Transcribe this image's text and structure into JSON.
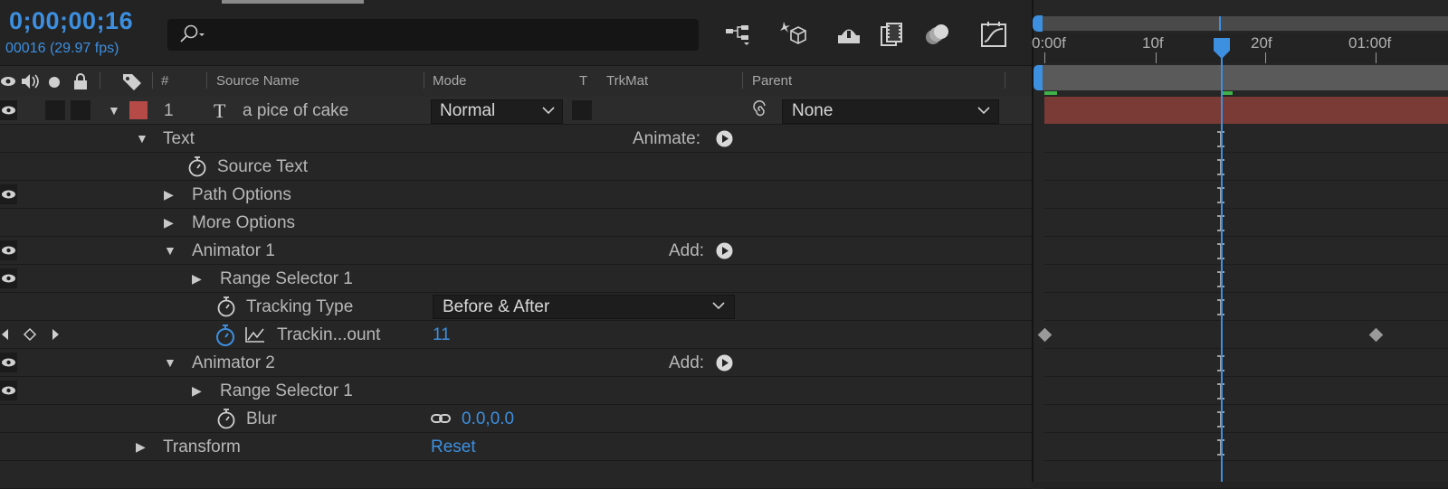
{
  "header": {
    "timecode": "0;00;00;16",
    "frame_info": "00016 (29.97 fps)",
    "search_value": "",
    "tools": [
      "flowchart-icon",
      "draft-3d-icon",
      "shy-layers-icon",
      "frame-blending-icon",
      "motion-blur-icon",
      "graph-editor-icon"
    ]
  },
  "columns": {
    "source_name": "Source Name",
    "mode": "Mode",
    "t": "T",
    "trkmat": "TrkMat",
    "parent": "Parent",
    "number": "#"
  },
  "layer": {
    "number": "1",
    "type_glyph": "T",
    "name": "a pice of cake",
    "mode": "Normal",
    "parent": "None",
    "label_color": "#b64a46"
  },
  "rows": {
    "text": "Text",
    "animate": "Animate:",
    "source_text": "Source Text",
    "path_options": "Path Options",
    "more_options": "More Options",
    "animator1": "Animator 1",
    "add1": "Add:",
    "range_selector1": "Range Selector 1",
    "tracking_type": "Tracking Type",
    "tracking_type_value": "Before & After",
    "tracking_amount": "Trackin...ount",
    "tracking_amount_value": "11",
    "animator2": "Animator 2",
    "add2": "Add:",
    "range_selector2": "Range Selector 1",
    "blur": "Blur",
    "blur_value": "0.0,0.0",
    "transform": "Transform",
    "transform_reset": "Reset"
  },
  "timeline": {
    "ruler_labels": [
      "0:00f",
      "10f",
      "20f",
      "01:00f"
    ],
    "current_frame": 16,
    "layer_bar_color": "#7a3a36",
    "accent": "#3d8fe0"
  }
}
